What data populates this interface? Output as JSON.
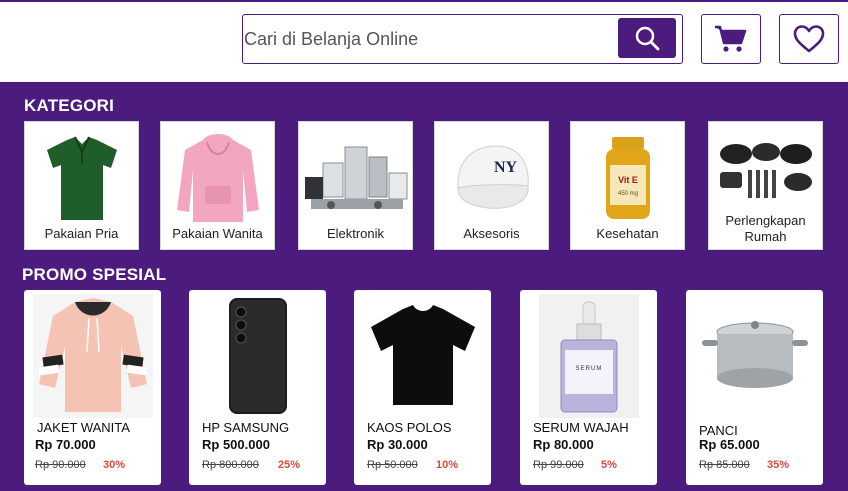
{
  "header": {
    "search": {
      "placeholder": "Cari di Belanja Online",
      "value": ""
    },
    "search_icon": "search-icon",
    "cart_icon": "cart-icon",
    "wishlist_icon": "heart-icon"
  },
  "colors": {
    "brand": "#4b1c7d",
    "discount": "#e0473b",
    "card_bg": "#ffffff"
  },
  "kategori": {
    "title": "KATEGORI",
    "items": [
      {
        "label": "Pakaian Pria"
      },
      {
        "label": "Pakaian Wanita"
      },
      {
        "label": "Elektronik"
      },
      {
        "label": "Aksesoris"
      },
      {
        "label": "Kesehatan"
      },
      {
        "label": "Perlengkapan Rumah"
      }
    ]
  },
  "promo": {
    "title": "PROMO SPESIAL",
    "items": [
      {
        "name": "JAKET WANITA",
        "price": "Rp 70.000",
        "old_price": "Rp 90.000",
        "discount": "30%"
      },
      {
        "name": "HP SAMSUNG",
        "price": "Rp 500.000",
        "old_price": "Rp 800.000",
        "discount": "25%"
      },
      {
        "name": "KAOS POLOS",
        "price": "Rp 30.000",
        "old_price": "Rp 50.000",
        "discount": "10%"
      },
      {
        "name": "SERUM WAJAH",
        "price": "Rp 80.000",
        "old_price": "Rp 99.000",
        "discount": "5%"
      },
      {
        "name": "PANCI",
        "price": "Rp 65.000",
        "old_price": "Rp 85.000",
        "discount": "35%"
      }
    ]
  }
}
